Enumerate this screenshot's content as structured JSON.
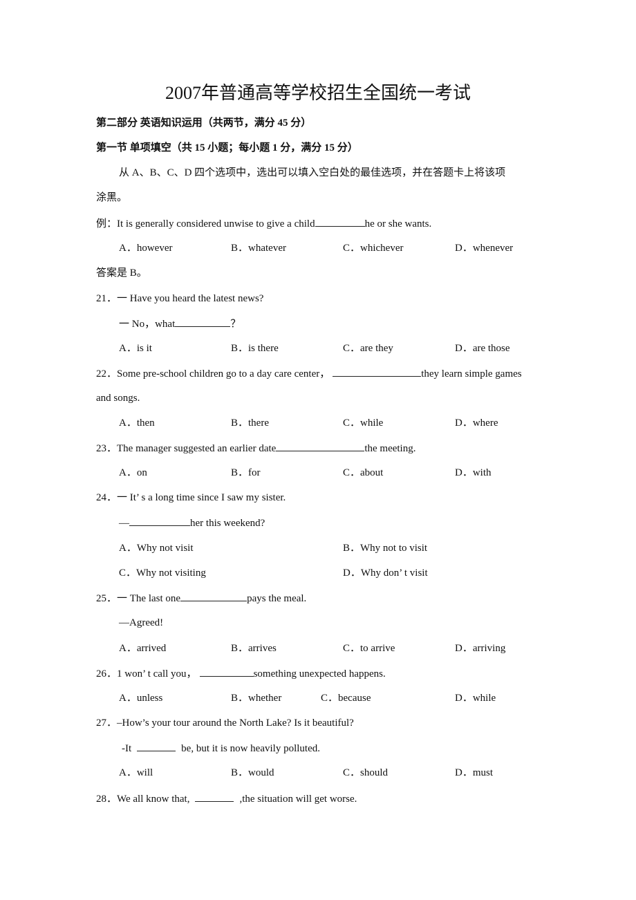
{
  "title": "2007年普通高等学校招生全国统一考试",
  "part_heading": "第二部分  英语知识运用（共两节，满分 45 分）",
  "section_heading": "第一节  单项填空（共 15 小题；每小题 1 分，满分 15 分）",
  "instructions_line1": "从 A、B、C、D 四个选项中，选出可以填入空白处的最佳选项，并在答题卡上将该项",
  "instructions_line2": "涂黑。",
  "example": {
    "prefix": "例：It is generally considered unwise to give a child",
    "suffix": "he or she wants.",
    "options": [
      "A．however",
      "B．whatever",
      "C．whichever",
      "D．whenever"
    ],
    "answer": "答案是 B。"
  },
  "questions": [
    {
      "number": "21．",
      "line1": "一 Have you heard the latest news?",
      "line2_prefix": "一 No，what",
      "line2_suffix": "？",
      "options": [
        "A．is it",
        "B．is there",
        "C．are they",
        "D．are those"
      ]
    },
    {
      "number": "22．",
      "line1_prefix": "Some pre-school children go to a day care center，",
      "line1_suffix": "they learn simple games",
      "line2": "and songs.",
      "options": [
        "A．then",
        "B．there",
        "C．while",
        "D．where"
      ]
    },
    {
      "number": "23．",
      "line1_prefix": "The manager suggested an earlier date",
      "line1_suffix": "the meeting.",
      "options": [
        "A．on",
        "B．for",
        "C．about",
        "D．with"
      ]
    },
    {
      "number": "24．",
      "line1": "一 It’ s a long time since I saw my sister.",
      "line2_prefix": "—",
      "line2_suffix": "her this weekend?",
      "options": [
        "A．Why not visit",
        "B．Why not to visit",
        "C．Why not visiting",
        "D．Why don’ t visit"
      ]
    },
    {
      "number": "25．",
      "line1_prefix": "一 The last one",
      "line1_suffix": "pays the meal.",
      "line2": "—Agreed!",
      "options": [
        "A．arrived",
        "B．arrives",
        "C．to arrive",
        "D．arriving"
      ]
    },
    {
      "number": "26．",
      "line1_prefix": "1 won’ t call you，",
      "line1_suffix": "something unexpected happens.",
      "options": [
        "A．unless",
        "B．whether",
        "C．because",
        "D．while"
      ]
    },
    {
      "number": "27．",
      "line1": "–How’s your tour around the North Lake? Is it beautiful?",
      "line2_prefix": "-It",
      "line2_suffix": "be, but it is now heavily polluted.",
      "options": [
        "A．will",
        "B．would",
        "C．should",
        "D．must"
      ]
    },
    {
      "number": "28．",
      "line1_prefix": "We all know that,",
      "line1_suffix": ",the situation will get worse."
    }
  ]
}
